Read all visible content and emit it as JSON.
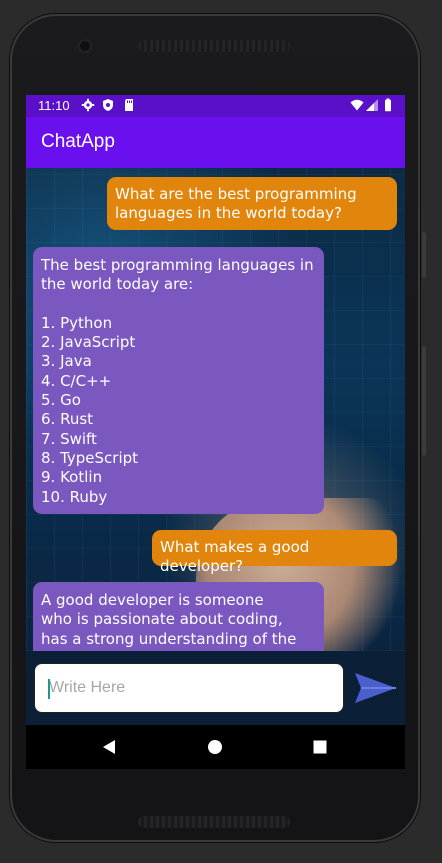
{
  "status_bar": {
    "time": "11:10",
    "left_icons": [
      "gear-icon",
      "shield-icon",
      "sd-card-icon"
    ],
    "right_icons": [
      "wifi-icon",
      "signal-icon",
      "battery-icon"
    ],
    "color": "#5a0fc8"
  },
  "app_bar": {
    "title": "ChatApp",
    "color": "#6a10ee"
  },
  "chat": {
    "messages": [
      {
        "role": "user",
        "text": "What are the best programming\nlanguages in the world today?"
      },
      {
        "role": "bot",
        "text": "The best programming languages in\nthe world today are:\n\n1. Python\n2. JavaScript\n3. Java\n4. C/C++\n5. Go\n6. Rust\n7. Swift\n8. TypeScript\n9. Kotlin\n10. Ruby"
      },
      {
        "role": "user",
        "text": "What makes a good developer?"
      },
      {
        "role": "bot",
        "text": "A good developer is someone\nwho is passionate about coding,\nhas a strong understanding of the"
      }
    ],
    "user_bubble_color": "#e2850c",
    "bot_bubble_color": "#7b57c0"
  },
  "composer": {
    "placeholder": "Write Here",
    "value": "",
    "send_icon": "send-arrow-icon",
    "send_color": "#4a5fcf"
  },
  "nav_bar": {
    "buttons": [
      "back-icon",
      "home-icon",
      "recents-icon"
    ]
  }
}
